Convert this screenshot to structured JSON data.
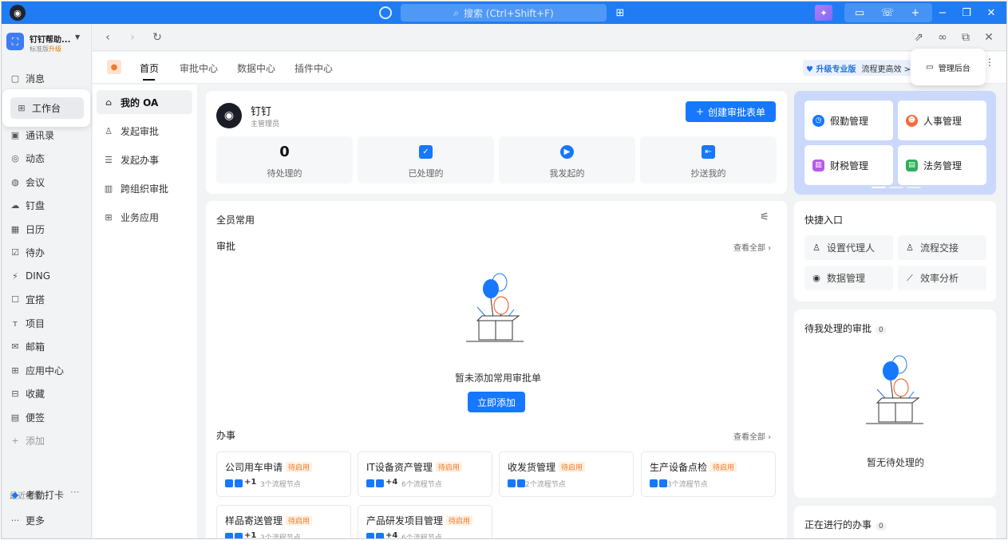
{
  "titlebar": {
    "search_placeholder": "搜索 (Ctrl+Shift+F)"
  },
  "org": {
    "name": "钉钉帮助...",
    "edition": "标准版",
    "upgrade": "升级"
  },
  "nav": [
    {
      "label": "消息",
      "icon": "message-icon"
    },
    {
      "label": "工作台",
      "icon": "grid-icon",
      "active": true
    },
    {
      "label": "通讯录",
      "icon": "contacts-icon"
    },
    {
      "label": "动态",
      "icon": "feed-icon"
    },
    {
      "label": "会议",
      "icon": "meeting-icon"
    },
    {
      "label": "钉盘",
      "icon": "cloud-drive-icon"
    },
    {
      "label": "日历",
      "icon": "calendar-icon"
    },
    {
      "label": "待办",
      "icon": "todo-icon"
    },
    {
      "label": "DING",
      "icon": "ding-icon"
    },
    {
      "label": "宜搭",
      "icon": "yida-icon"
    },
    {
      "label": "项目",
      "icon": "project-icon"
    },
    {
      "label": "邮箱",
      "icon": "mail-icon"
    },
    {
      "label": "应用中心",
      "icon": "app-center-icon"
    },
    {
      "label": "收藏",
      "icon": "favorites-icon"
    },
    {
      "label": "便签",
      "icon": "note-icon"
    },
    {
      "label": "添加",
      "icon": "plus-icon"
    }
  ],
  "recent": {
    "label": "最近使用",
    "item": "考勤打卡",
    "more": "更多"
  },
  "tabs": [
    {
      "label": "首页",
      "active": true
    },
    {
      "label": "审批中心"
    },
    {
      "label": "数据中心"
    },
    {
      "label": "插件中心"
    }
  ],
  "upgrade_bar": {
    "pro": "升级专业版",
    "slogan": "流程更高效 >"
  },
  "admin_popup": {
    "label": "管理后台"
  },
  "submenu": [
    {
      "label": "我的 OA",
      "active": true
    },
    {
      "label": "发起审批"
    },
    {
      "label": "发起办事"
    },
    {
      "label": "跨组织审批"
    },
    {
      "label": "业务应用"
    }
  ],
  "user": {
    "name": "钉钉",
    "role": "主管理员"
  },
  "create_button": "创建审批表单",
  "stats": [
    {
      "label": "待处理的",
      "value": "0"
    },
    {
      "label": "已处理的",
      "icon": "check-icon"
    },
    {
      "label": "我发起的",
      "icon": "send-icon"
    },
    {
      "label": "抄送我的",
      "icon": "cc-icon"
    }
  ],
  "common": {
    "title": "全员常用",
    "approval_title": "审批",
    "see_all": "查看全部",
    "empty_text": "暂未添加常用审批单",
    "add_button": "立即添加",
    "tasks_title": "办事",
    "tasks_see_all": "查看全部"
  },
  "processes": [
    {
      "name": "公司用车申请",
      "tag": "待启用",
      "plus": "+1",
      "nodes": "3个流程节点"
    },
    {
      "name": "IT设备资产管理",
      "tag": "待启用",
      "plus": "+4",
      "nodes": "6个流程节点"
    },
    {
      "name": "收发货管理",
      "tag": "待启用",
      "plus": "",
      "nodes": "2个流程节点"
    },
    {
      "name": "生产设备点检",
      "tag": "待启用",
      "plus": "",
      "nodes": "3个流程节点"
    },
    {
      "name": "样品寄送管理",
      "tag": "待启用",
      "plus": "+1",
      "nodes": "3个流程节点"
    },
    {
      "name": "产品研发项目管理",
      "tag": "待启用",
      "plus": "+4",
      "nodes": "6个流程节点"
    }
  ],
  "right_apps": [
    {
      "label": "假勤管理",
      "color": "#1677ff"
    },
    {
      "label": "人事管理",
      "color": "#f26b3a"
    },
    {
      "label": "财税管理",
      "color": "#b65be8"
    },
    {
      "label": "法务管理",
      "color": "#2fae5a"
    }
  ],
  "quick_entry": {
    "title": "快捷入口",
    "items": [
      "设置代理人",
      "流程交接",
      "数据管理",
      "效率分析"
    ]
  },
  "pending": {
    "title": "待我处理的审批",
    "count": "0",
    "empty_text": "暂无待处理的"
  },
  "in_progress": {
    "title": "正在进行的办事",
    "count": "0"
  }
}
